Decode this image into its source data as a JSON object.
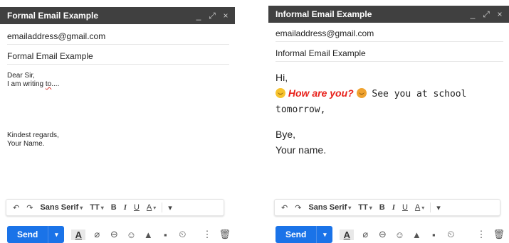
{
  "left": {
    "title": "Formal Email Example",
    "to": "emailaddress@gmail.com",
    "subject": "Formal Email Example",
    "body": {
      "l1": "Dear Sir,",
      "l2a": "I am writing ",
      "l2b": "to",
      "l2c": "....",
      "l3": "",
      "l4": "",
      "l5": "",
      "l6": "Kindest regards,",
      "l7": "Your Name."
    }
  },
  "right": {
    "title": "Informal Email Example",
    "to": "emailaddress@gmail.com",
    "subject": "Informal Email Example",
    "body": {
      "l1": "Hi,",
      "how": "How are you?",
      "rest1": " See you at school",
      "rest2": "tomorrow,",
      "l4": "",
      "l5": "Bye,",
      "l6": "Your name."
    }
  },
  "window_controls": {
    "minimize": "_",
    "popout": "⤢",
    "close": "×"
  },
  "toolbar": {
    "undo": "↶",
    "redo": "↷",
    "font": "Sans Serif",
    "size_icon": "TT",
    "bold": "B",
    "italic": "I",
    "underline": "U",
    "text_color": "A",
    "more": "▾",
    "caret": "▾"
  },
  "bottom": {
    "send": "Send",
    "send_dd": "▾",
    "format": "A",
    "attach": "⌀",
    "link": "⊖",
    "emoji": "☺",
    "drive": "▲",
    "photo": "▪",
    "confidential": "⏲",
    "more": "⋮",
    "trash": "🗑"
  },
  "colors": {
    "titlebar": "#404040",
    "send": "#1a73e8",
    "highlight": "#e8211b"
  }
}
